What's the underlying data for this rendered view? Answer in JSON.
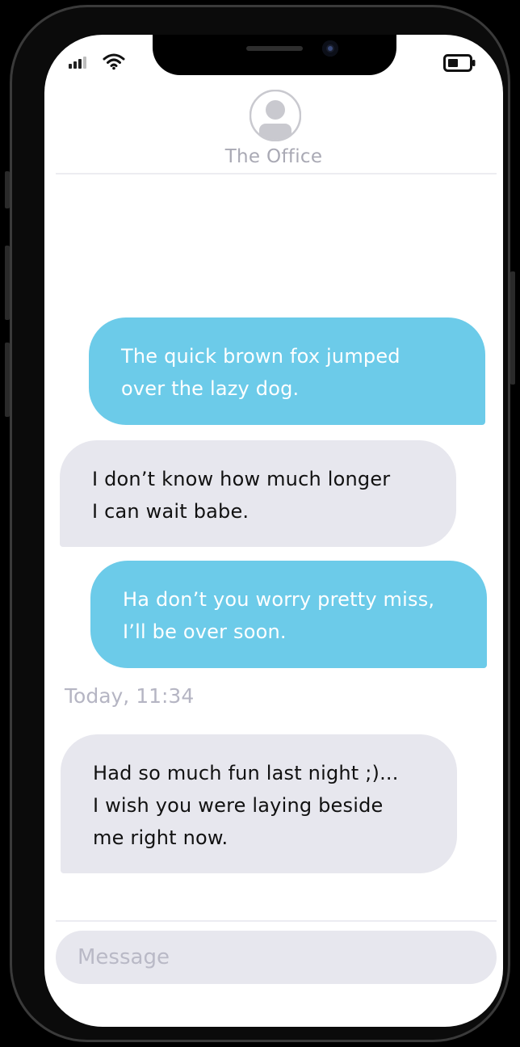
{
  "status_bar": {
    "signal_icon": "cellular-signal-icon",
    "wifi_icon": "wifi-icon",
    "battery_icon": "battery-icon"
  },
  "header": {
    "contact_name": "The Office",
    "avatar_icon": "person-avatar-icon"
  },
  "messages": [
    {
      "direction": "outgoing",
      "lines": [
        "The quick brown fox jumped",
        "over the lazy dog."
      ]
    },
    {
      "direction": "incoming",
      "lines": [
        "I don’t know how much longer",
        "I can wait babe."
      ]
    },
    {
      "direction": "outgoing",
      "lines": [
        "Ha don’t you worry pretty miss,",
        "I’ll be over soon."
      ]
    },
    {
      "direction": "incoming",
      "lines": [
        "Had so much fun last night ;)...",
        "I wish you were laying beside",
        "me right now."
      ]
    }
  ],
  "timestamp": "Today, 11:34",
  "composer": {
    "placeholder": "Message"
  },
  "colors": {
    "outgoing_bubble": "#6ccbe9",
    "incoming_bubble": "#e7e7ee",
    "muted_text": "#a9a9b4"
  }
}
